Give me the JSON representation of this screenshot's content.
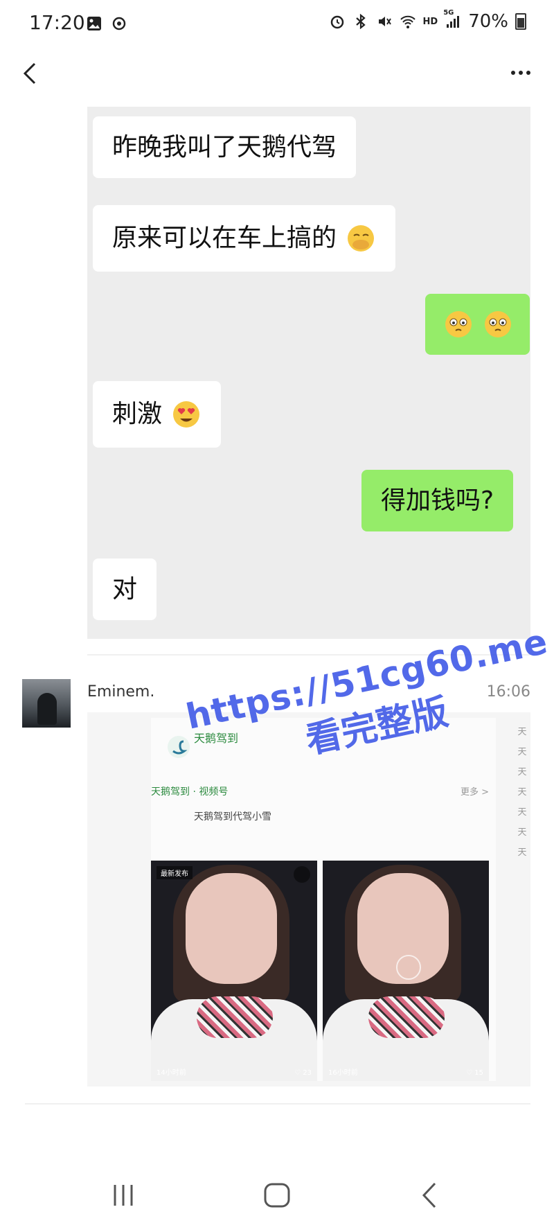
{
  "status_bar": {
    "time": "17:20",
    "network": "5G",
    "signal_hd": "HD",
    "battery": "70%"
  },
  "chat_screenshot": {
    "messages": [
      {
        "side": "left",
        "text": "昨晚我叫了天鹅代驾"
      },
      {
        "side": "left",
        "text": "原来可以在车上搞的",
        "emoji": "hand-over-mouth-icon"
      },
      {
        "side": "right",
        "text": "",
        "emoji": "tearful-face-icon x2"
      },
      {
        "side": "left",
        "text": "刺激",
        "emoji": "heart-eyes-icon"
      },
      {
        "side": "right",
        "text": "得加钱吗?"
      },
      {
        "side": "left",
        "text": "对"
      }
    ]
  },
  "forwarded_message": {
    "sender": "Eminem.",
    "time": "16:06",
    "card": {
      "account_name": "天鹅驾到",
      "section_head": "天鹅驾到 · 视频号",
      "section_more": "更多 >",
      "channel_name": "天鹅驾到代驾小雪",
      "video_a": {
        "badge": "最新发布",
        "ago": "14小时前",
        "likes": "23"
      },
      "video_b": {
        "ago": "16小时前",
        "likes": "15"
      },
      "side_column": [
        "天",
        "天",
        "天",
        "天",
        "天",
        "天",
        "天"
      ]
    }
  },
  "watermark": {
    "url": "https://51cg60.me",
    "text": "看完整版"
  },
  "colors": {
    "bubble_self": "#95ec69",
    "bubble_other": "#ffffff",
    "chat_bg": "#ededed",
    "watermark": "#3b55e6"
  }
}
